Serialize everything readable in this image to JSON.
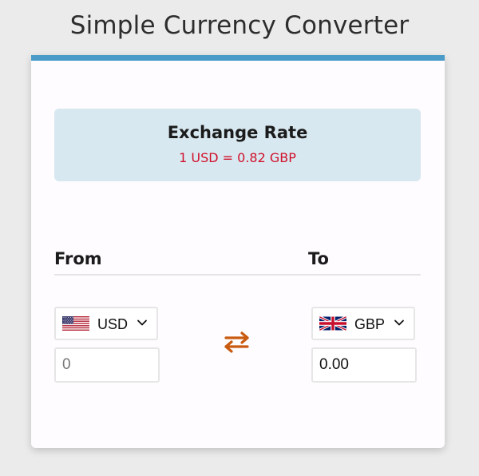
{
  "page": {
    "title": "Simple Currency Converter"
  },
  "rate": {
    "title": "Exchange Rate",
    "value": "1 USD = 0.82 GBP"
  },
  "from": {
    "label": "From",
    "currency": "USD",
    "flag": "us-flag-icon",
    "amount_placeholder": "0",
    "amount_value": ""
  },
  "to": {
    "label": "To",
    "currency": "GBP",
    "flag": "uk-flag-icon",
    "amount_value": "0.00"
  },
  "swap": {
    "icon": "swap-arrows-icon"
  },
  "colors": {
    "accent_bar": "#4a9bc8",
    "rate_box": "#d8e8f0",
    "rate_text": "#d0112b",
    "swap_icon": "#c95a10"
  }
}
